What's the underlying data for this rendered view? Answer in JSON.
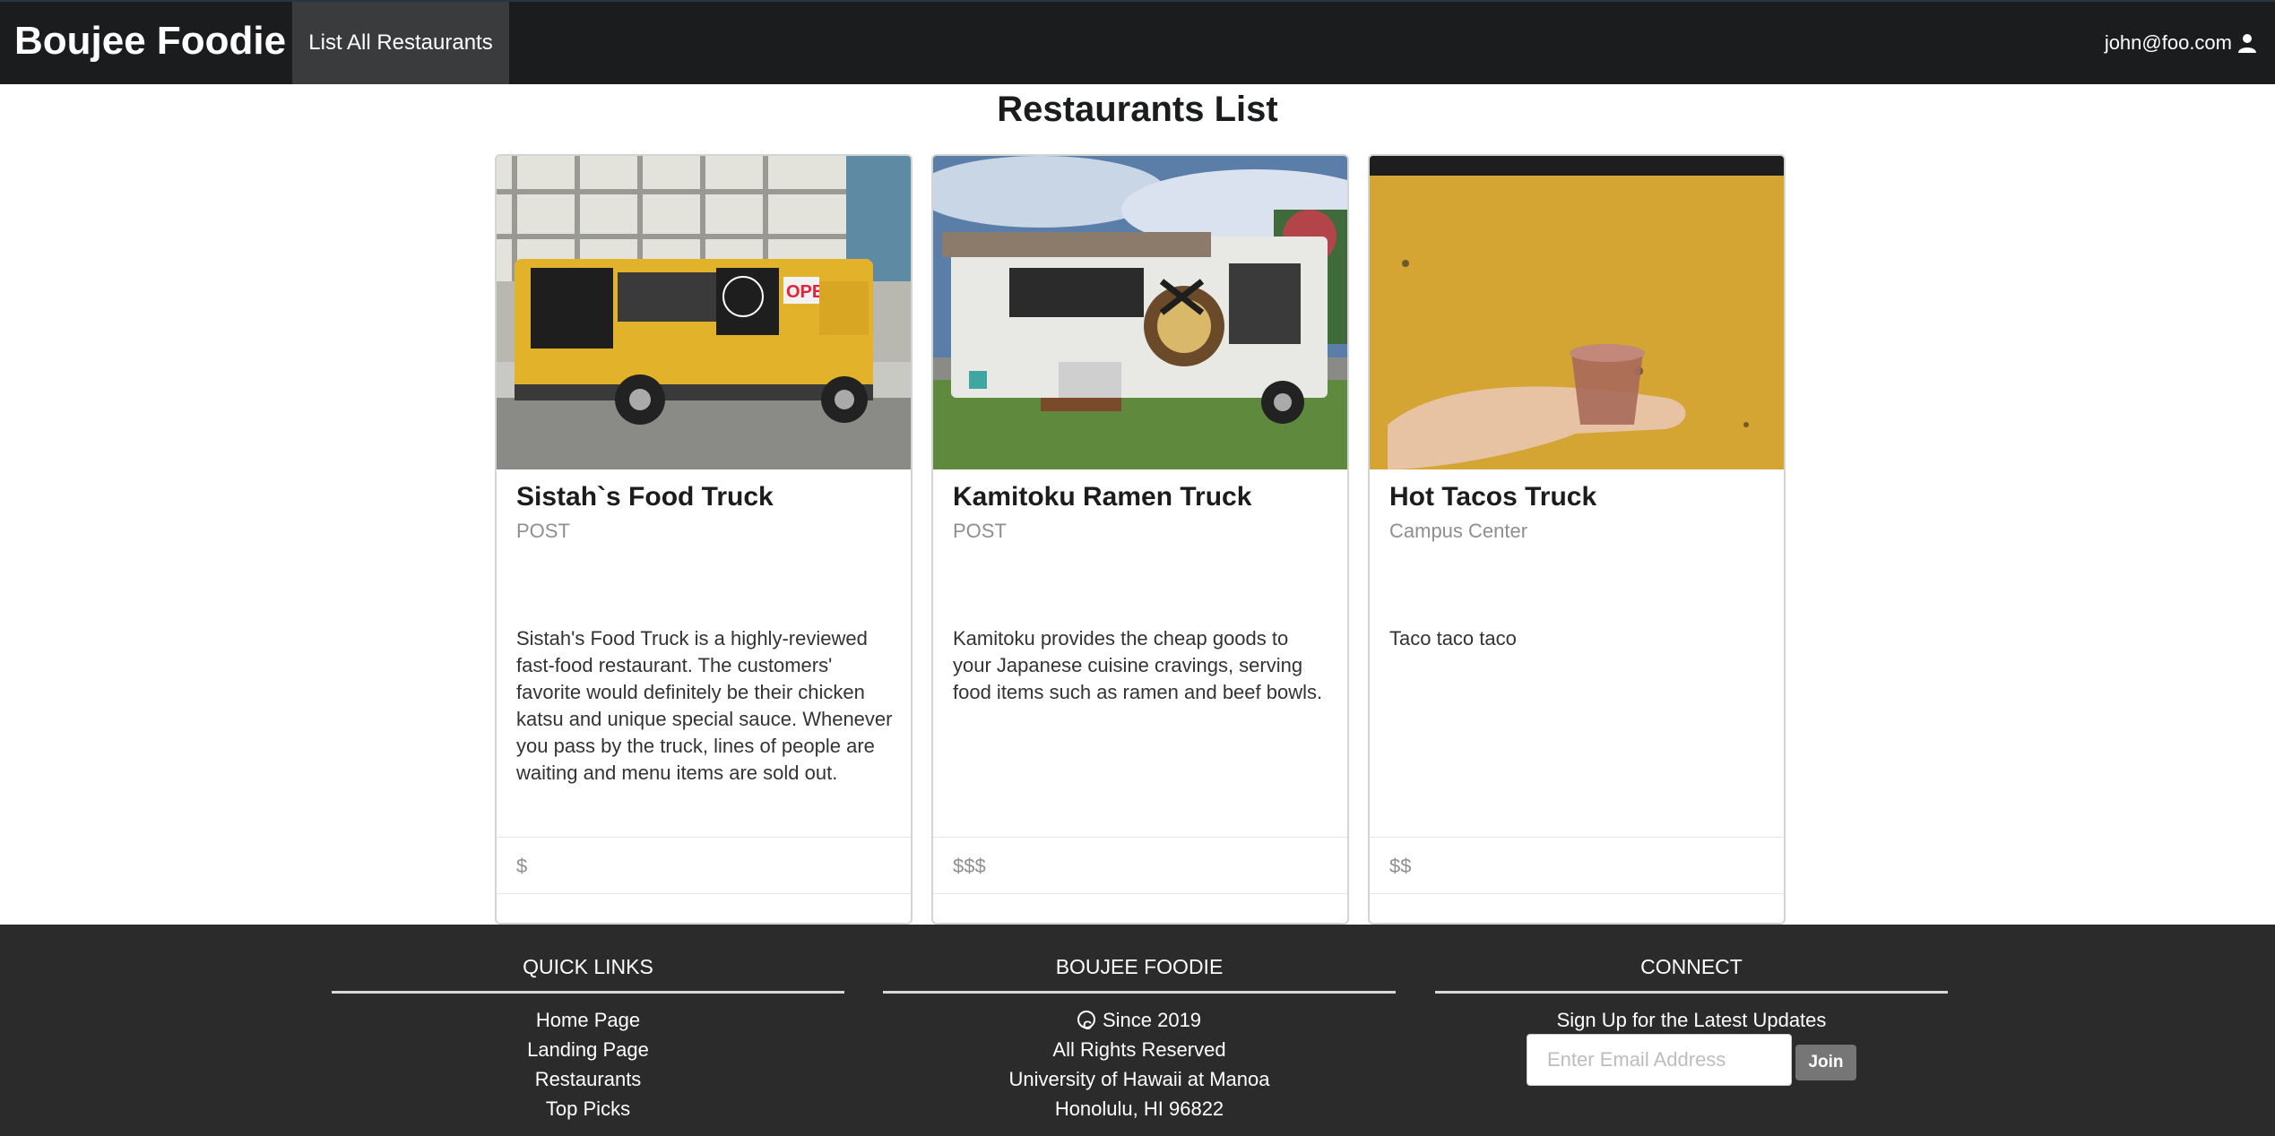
{
  "navbar": {
    "brand": "Boujee Foodie",
    "nav_item": "List All Restaurants",
    "user_email": "john@foo.com",
    "user_icon": "user-icon"
  },
  "page": {
    "title": "Restaurants List"
  },
  "restaurants": [
    {
      "name": "Sistah`s Food Truck",
      "location": "POST",
      "description": "Sistah's Food Truck is a highly-reviewed fast-food restaurant. The customers' favorite would definitely be their chicken katsu and unique special sauce. Whenever you pass by the truck, lines of people are waiting and menu items are sold out.",
      "price": "$",
      "image_alt": "yellow food truck photo"
    },
    {
      "name": "Kamitoku Ramen Truck",
      "location": "POST",
      "description": "Kamitoku provides the cheap goods to your Japanese cuisine cravings, serving food items such as ramen and beef bowls.",
      "price": "$$$",
      "image_alt": "white ramen truck photo"
    },
    {
      "name": "Hot Tacos Truck",
      "location": "Campus Center",
      "description": "Taco taco taco",
      "price": "$$",
      "image_alt": "hot tacos truck sign photo"
    }
  ],
  "footer": {
    "quick_links": {
      "heading": "QUICK LINKS",
      "items": [
        "Home Page",
        "Landing Page",
        "Restaurants",
        "Top Picks"
      ]
    },
    "about": {
      "heading": "BOUJEE FOODIE",
      "since": "Since 2019",
      "rights": "All Rights Reserved",
      "university": "University of Hawaii at Manoa",
      "address": "Honolulu, HI 96822"
    },
    "connect": {
      "heading": "CONNECT",
      "signup_text": "Sign Up for the Latest Updates",
      "email_placeholder": "Enter Email Address",
      "join_label": "Join"
    }
  },
  "colors": {
    "navbar_bg": "#1b1c1d",
    "nav_active_bg": "#3a3b3c",
    "footer_bg": "#2b2b2b",
    "join_button_bg": "#767676"
  }
}
